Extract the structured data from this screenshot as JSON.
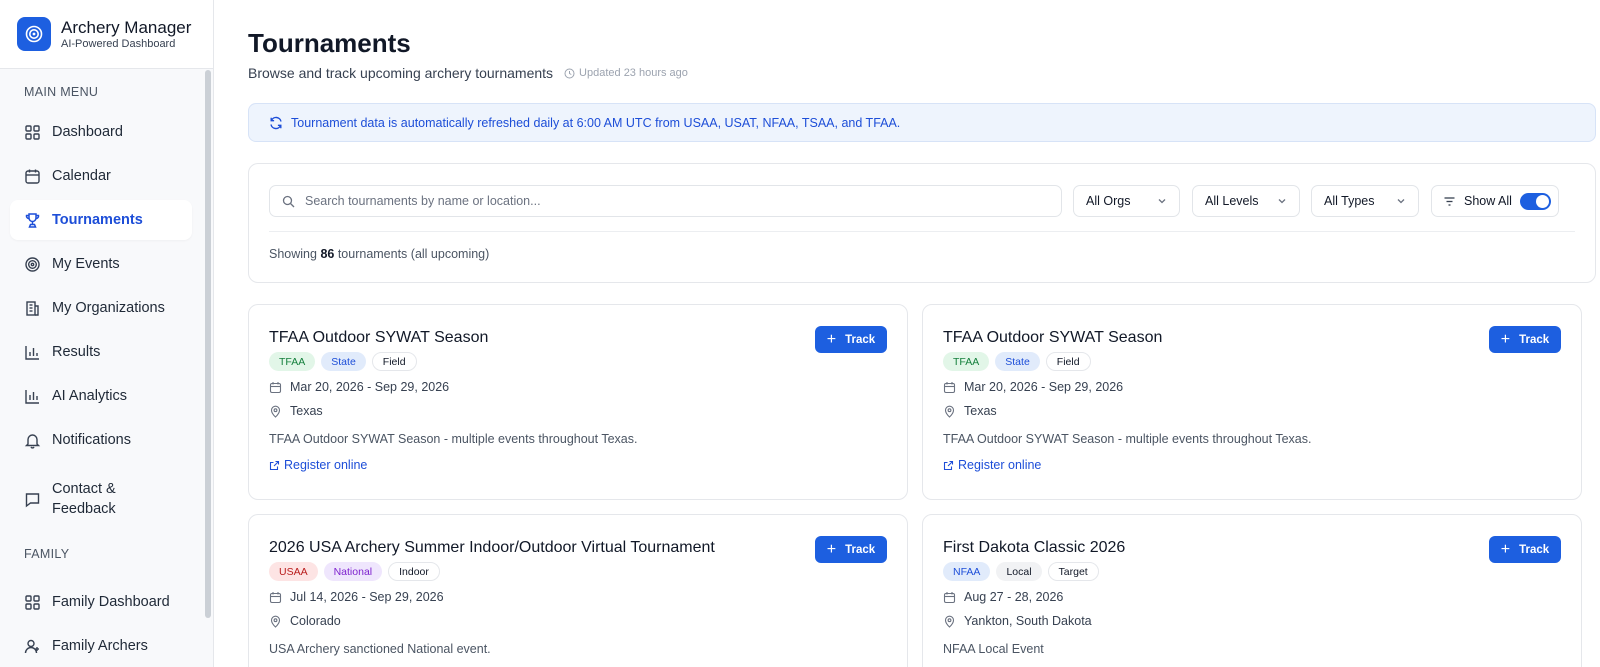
{
  "app": {
    "name": "Archery Manager",
    "subtitle": "AI-Powered Dashboard"
  },
  "sidebar": {
    "main_menu_label": "MAIN MENU",
    "items": [
      {
        "label": "Dashboard",
        "icon": "grid-icon"
      },
      {
        "label": "Calendar",
        "icon": "calendar-icon"
      },
      {
        "label": "Tournaments",
        "icon": "trophy-icon",
        "active": true
      },
      {
        "label": "My Events",
        "icon": "target-icon"
      },
      {
        "label": "My Organizations",
        "icon": "building-icon"
      },
      {
        "label": "Results",
        "icon": "bar-chart-icon"
      },
      {
        "label": "AI Analytics",
        "icon": "bar-chart-icon"
      },
      {
        "label": "Notifications",
        "icon": "bell-icon"
      },
      {
        "label": "Contact & Feedback",
        "icon": "message-icon"
      }
    ],
    "family_label": "FAMILY",
    "family_items": [
      {
        "label": "Family Dashboard",
        "icon": "grid-icon"
      },
      {
        "label": "Family Archers",
        "icon": "user-plus-icon"
      }
    ]
  },
  "header": {
    "title": "Tournaments",
    "subtitle": "Browse and track upcoming archery tournaments",
    "updated": "Updated 23 hours ago"
  },
  "banner": {
    "text": "Tournament data is automatically refreshed daily at 6:00 AM UTC from USAA, USAT, NFAA, TSAA, and TFAA."
  },
  "filters": {
    "search_placeholder": "Search tournaments by name or location...",
    "orgs": "All Orgs",
    "levels": "All Levels",
    "types": "All Types",
    "show_all": "Show All",
    "show_all_on": true,
    "showing_prefix": "Showing",
    "showing_count": "86",
    "showing_suffix": "tournaments (all upcoming)"
  },
  "track_label": "Track",
  "tournaments": [
    {
      "title": "TFAA Outdoor SYWAT Season",
      "tags": [
        {
          "label": "TFAA",
          "color": "green"
        },
        {
          "label": "State",
          "color": "blue"
        },
        {
          "label": "Field",
          "color": "plain"
        }
      ],
      "dates": "Mar 20, 2026 - Sep 29, 2026",
      "location": "Texas",
      "description": "TFAA Outdoor SYWAT Season - multiple events throughout Texas.",
      "register": "Register online"
    },
    {
      "title": "TFAA Outdoor SYWAT Season",
      "tags": [
        {
          "label": "TFAA",
          "color": "green"
        },
        {
          "label": "State",
          "color": "blue"
        },
        {
          "label": "Field",
          "color": "plain"
        }
      ],
      "dates": "Mar 20, 2026 - Sep 29, 2026",
      "location": "Texas",
      "description": "TFAA Outdoor SYWAT Season - multiple events throughout Texas.",
      "register": "Register online"
    },
    {
      "title": "2026 USA Archery Summer Indoor/Outdoor Virtual Tournament",
      "tags": [
        {
          "label": "USAA",
          "color": "red"
        },
        {
          "label": "National",
          "color": "purple"
        },
        {
          "label": "Indoor",
          "color": "plain"
        }
      ],
      "dates": "Jul 14, 2026 - Sep 29, 2026",
      "location": "Colorado",
      "description": "USA Archery sanctioned National event."
    },
    {
      "title": "First Dakota Classic 2026",
      "tags": [
        {
          "label": "NFAA",
          "color": "blue"
        },
        {
          "label": "Local",
          "color": "gray"
        },
        {
          "label": "Target",
          "color": "plain"
        }
      ],
      "dates": "Aug 27 - 28, 2026",
      "location": "Yankton, South Dakota",
      "description": "NFAA Local Event"
    }
  ]
}
